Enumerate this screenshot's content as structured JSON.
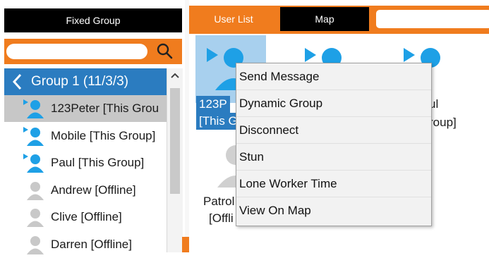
{
  "left_panel": {
    "tab_label": "Fixed Group",
    "search": {
      "value": "",
      "placeholder": ""
    },
    "group": {
      "title": "Group 1 (11/3/3)"
    },
    "members": [
      {
        "label": "123Peter [This Grou",
        "status": "online",
        "selected": true
      },
      {
        "label": "Mobile [This Group]",
        "status": "online",
        "selected": false
      },
      {
        "label": "Paul [This Group]",
        "status": "online",
        "selected": false
      },
      {
        "label": "Andrew [Offline]",
        "status": "offline",
        "selected": false
      },
      {
        "label": "Clive [Offline]",
        "status": "offline",
        "selected": false
      },
      {
        "label": "Darren [Offline]",
        "status": "offline",
        "selected": false
      }
    ]
  },
  "main": {
    "tabs": [
      {
        "label": "User List",
        "active": true
      },
      {
        "label": "Map",
        "active": false
      }
    ],
    "top_search": {
      "value": "",
      "placeholder": ""
    },
    "cards": [
      {
        "line1": "123P",
        "line2": "[This G",
        "status": "online"
      },
      {
        "line1": "",
        "line2": "",
        "status": "online"
      },
      {
        "line1": "ul",
        "line2": "roup]",
        "status": "online"
      },
      {
        "line1": "Patrol",
        "line2": "[Offli",
        "status": "offline"
      }
    ]
  },
  "context_menu": {
    "items": [
      "Send Message",
      "Dynamic Group",
      "Disconnect",
      "Stun",
      "Lone Worker Time",
      "View On Map"
    ]
  },
  "colors": {
    "accent_orange": "#f07c1e",
    "selection_blue": "#2b7cc0",
    "online_icon": "#1ea0e6",
    "offline_icon": "#c8c8c8"
  },
  "icons": {
    "search": "magnifier-icon",
    "collapse": "chevron-left-icon",
    "scroll_up": "chevron-up-icon",
    "online_user": "user-online-icon",
    "offline_user": "user-offline-icon"
  }
}
